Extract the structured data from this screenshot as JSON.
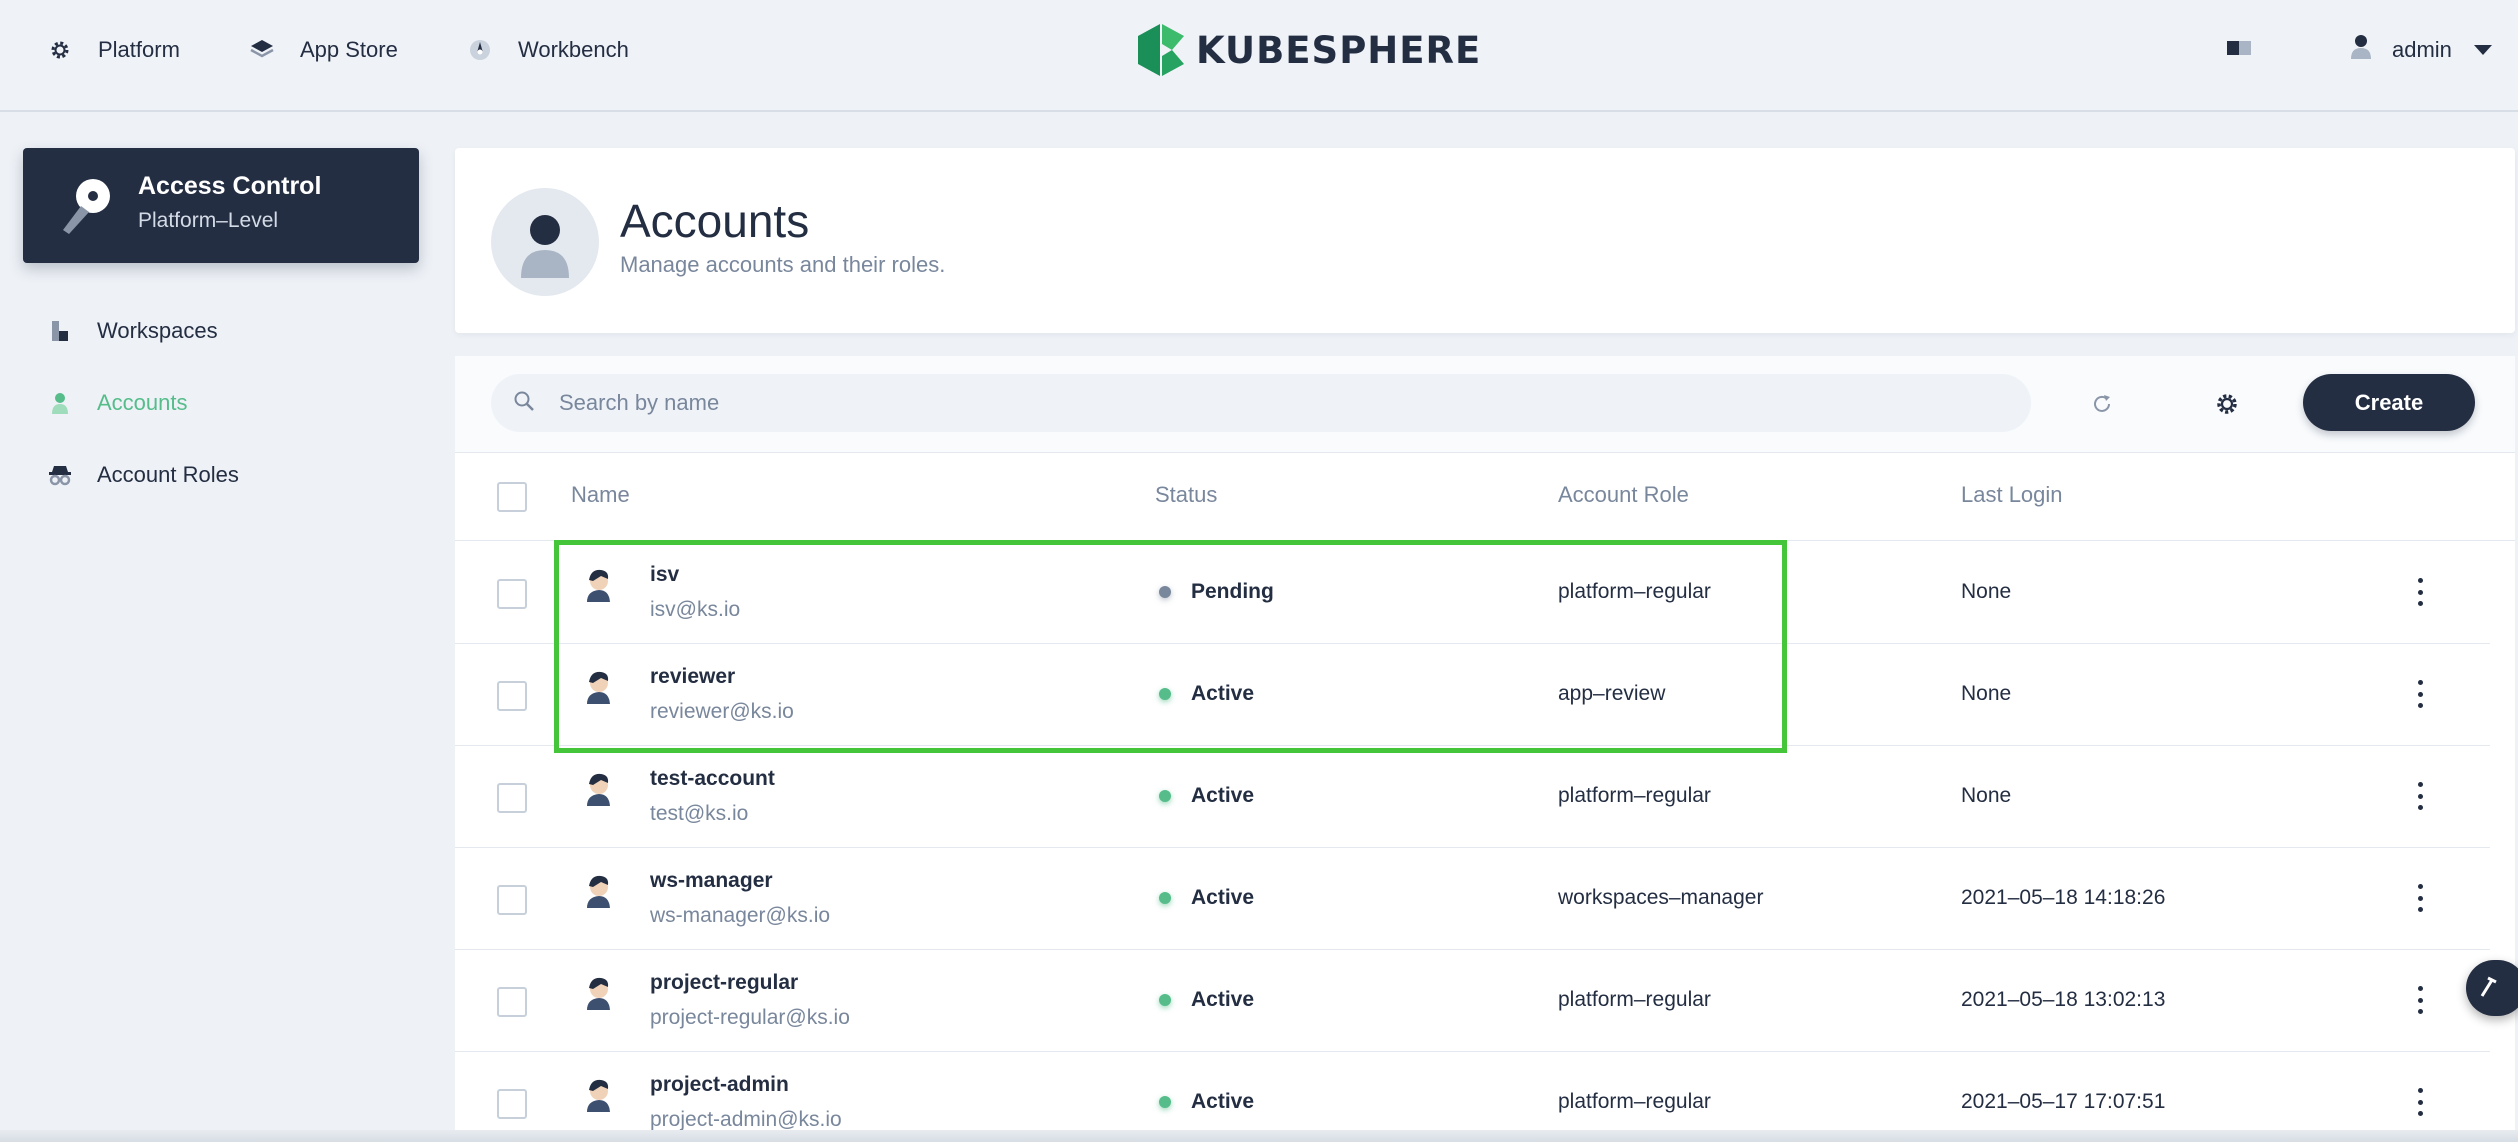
{
  "topbar": {
    "nav": [
      {
        "label": "Platform",
        "icon": "gear-icon"
      },
      {
        "label": "App Store",
        "icon": "layers-icon"
      },
      {
        "label": "Workbench",
        "icon": "compass-icon"
      }
    ],
    "brand": "KUBESPHERE",
    "user": "admin"
  },
  "sidebar": {
    "title": "Access Control",
    "subtitle": "Platform–Level",
    "items": [
      {
        "label": "Workspaces",
        "icon": "workspace-icon",
        "active": false
      },
      {
        "label": "Accounts",
        "icon": "user-icon",
        "active": true
      },
      {
        "label": "Account Roles",
        "icon": "roles-icon",
        "active": false
      }
    ]
  },
  "header": {
    "title": "Accounts",
    "description": "Manage accounts and their roles."
  },
  "toolbar": {
    "search_placeholder": "Search by name",
    "create_label": "Create"
  },
  "table": {
    "columns": [
      "Name",
      "Status",
      "Account Role",
      "Last Login"
    ],
    "rows": [
      {
        "name": "isv",
        "email": "isv@ks.io",
        "status": "Pending",
        "role": "platform–regular",
        "last_login": "None"
      },
      {
        "name": "reviewer",
        "email": "reviewer@ks.io",
        "status": "Active",
        "role": "app–review",
        "last_login": "None"
      },
      {
        "name": "test-account",
        "email": "test@ks.io",
        "status": "Active",
        "role": "platform–regular",
        "last_login": "None"
      },
      {
        "name": "ws-manager",
        "email": "ws-manager@ks.io",
        "status": "Active",
        "role": "workspaces–manager",
        "last_login": "2021–05–18 14:18:26"
      },
      {
        "name": "project-regular",
        "email": "project-regular@ks.io",
        "status": "Active",
        "role": "platform–regular",
        "last_login": "2021–05–18 13:02:13"
      },
      {
        "name": "project-admin",
        "email": "project-admin@ks.io",
        "status": "Active",
        "role": "platform–regular",
        "last_login": "2021–05–17 17:07:51"
      }
    ]
  },
  "colors": {
    "accent_green": "#55bc8a",
    "dark": "#242e42",
    "highlight": "#44c53a",
    "pending": "#79879c"
  }
}
